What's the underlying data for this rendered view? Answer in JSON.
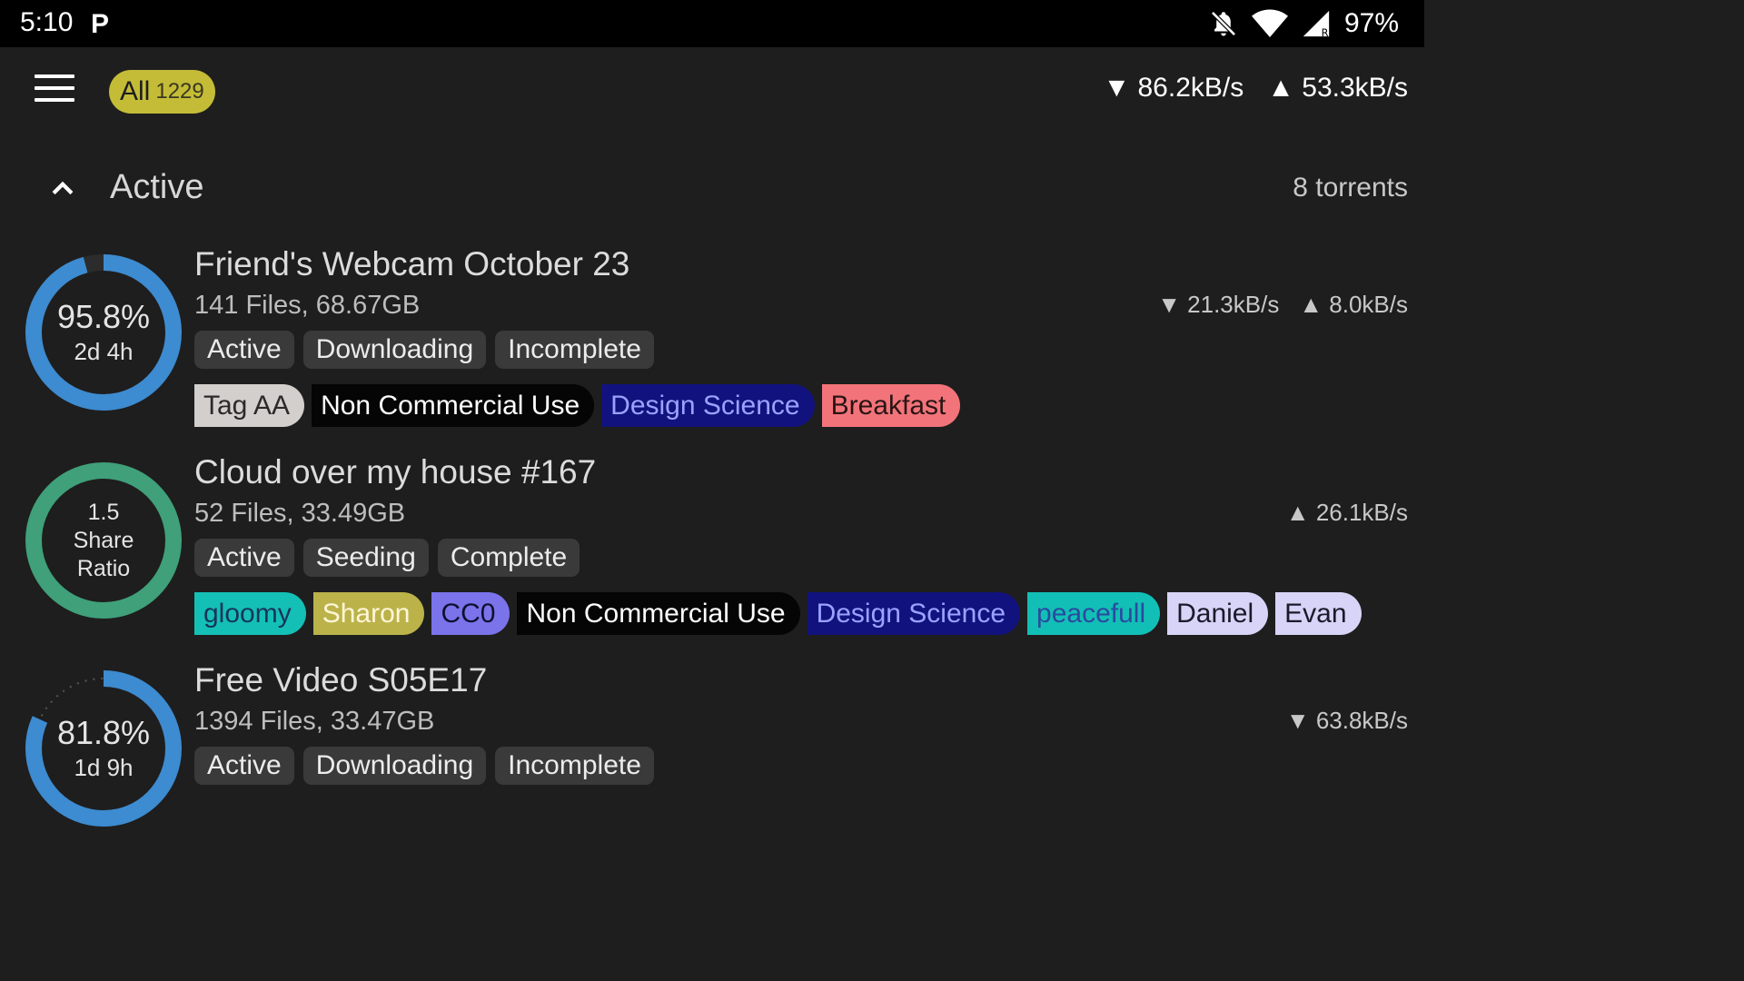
{
  "statusbar": {
    "time": "5:10",
    "app_icon": "P",
    "battery": "97%",
    "icons": [
      "notifications-off-icon",
      "wifi-icon",
      "cell-signal-icon"
    ]
  },
  "appbar": {
    "filter_label": "All",
    "filter_count": "1229",
    "download_speed": "▼ 86.2kB/s",
    "upload_speed": "▲ 53.3kB/s"
  },
  "section": {
    "title": "Active",
    "count": "8 torrents"
  },
  "torrents": [
    {
      "name": "Friend's Webcam October 23",
      "meta": "141 Files, 68.67GB",
      "progress_pct": 95.8,
      "ring_primary": "95.8%",
      "ring_secondary": "2d 4h",
      "download": "▼ 21.3kB/s",
      "upload": "▲ 8.0kB/s",
      "statuses": [
        "Active",
        "Downloading",
        "Incomplete"
      ],
      "tags": [
        {
          "label": "Tag AA",
          "bg": "#d2cfcc",
          "fg": "#2a2a2a"
        },
        {
          "label": "Non Commercial Use",
          "bg": "#050505",
          "fg": "#ffffff"
        },
        {
          "label": "Design Science",
          "bg": "#12127e",
          "fg": "#9aa2ff"
        },
        {
          "label": "Breakfast",
          "bg": "#f2747a",
          "fg": "#2a1414"
        }
      ]
    },
    {
      "name": "Cloud over my house #167",
      "meta": "52 Files, 33.49GB",
      "ring_lines": [
        "1.5",
        "Share",
        "Ratio"
      ],
      "download": "",
      "upload": "▲ 26.1kB/s",
      "statuses": [
        "Active",
        "Seeding",
        "Complete"
      ],
      "tags": [
        {
          "label": "gloomy",
          "bg": "#14bfb6",
          "fg": "#16355a"
        },
        {
          "label": "Sharon",
          "bg": "#bbb24a",
          "fg": "#fff6d6"
        },
        {
          "label": "CC0",
          "bg": "#7a73ea",
          "fg": "#101030"
        },
        {
          "label": "Non Commercial Use",
          "bg": "#050505",
          "fg": "#ffffff"
        },
        {
          "label": "Design Science",
          "bg": "#12127e",
          "fg": "#9aa2ff"
        },
        {
          "label": "peacefull",
          "bg": "#12bfb6",
          "fg": "#2a4aa0"
        },
        {
          "label": "Daniel",
          "bg": "#d7d4f7",
          "fg": "#1a1a2a"
        },
        {
          "label": "Evan",
          "bg": "#d7d4f7",
          "fg": "#1a1a2a"
        }
      ]
    },
    {
      "name": "Free Video S05E17",
      "meta": "1394 Files, 33.47GB",
      "progress_pct": 81.8,
      "ring_primary": "81.8%",
      "ring_secondary": "1d 9h",
      "download": "▼ 63.8kB/s",
      "upload": "",
      "statuses": [
        "Active",
        "Downloading",
        "Incomplete"
      ],
      "tags": []
    }
  ],
  "colors": {
    "download_ring": "#3d8bd0",
    "seed_ring": "#3fa07a",
    "ring_track": "#2c2c2c",
    "filter_chip": "#c4bc37"
  }
}
